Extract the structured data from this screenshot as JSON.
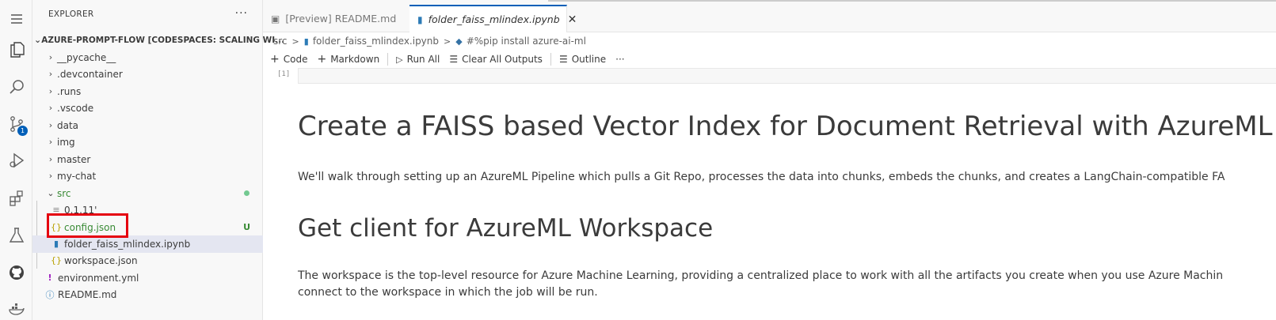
{
  "activity_bar": {
    "items": [
      "files-icon",
      "search-icon",
      "source-control-icon",
      "run-debug-icon",
      "extensions-icon",
      "testing-icon",
      "github-icon",
      "docker-icon"
    ],
    "source_control_badge": "1"
  },
  "explorer": {
    "title": "EXPLORER",
    "more": "···",
    "root": "AZURE-PROMPT-FLOW [CODESPACES: SCALING WI...",
    "items": [
      {
        "label": "__pycache__"
      },
      {
        "label": ".devcontainer"
      },
      {
        "label": ".runs"
      },
      {
        "label": ".vscode"
      },
      {
        "label": "data"
      },
      {
        "label": "img"
      },
      {
        "label": "master"
      },
      {
        "label": "my-chat"
      },
      {
        "label": "src"
      },
      {
        "label": "0.1.11'"
      },
      {
        "label": "config.json",
        "status": "U"
      },
      {
        "label": "folder_faiss_mlindex.ipynb"
      },
      {
        "label": "workspace.json"
      },
      {
        "label": "environment.yml"
      },
      {
        "label": "README.md"
      }
    ]
  },
  "tabs": [
    {
      "label": "[Preview] README.md"
    },
    {
      "label": "folder_faiss_mlindex.ipynb",
      "close": "✕"
    }
  ],
  "breadcrumb": {
    "items": [
      "src",
      "folder_faiss_mlindex.ipynb",
      "#%pip install azure-ai-ml"
    ],
    "separator": ">"
  },
  "toolbar": {
    "code": "Code",
    "markdown": "Markdown",
    "run_all": "Run All",
    "clear_outputs": "Clear All Outputs",
    "outline": "Outline",
    "more": "···"
  },
  "notebook": {
    "exec_count": "[1]",
    "h1": "Create a FAISS based Vector Index for Document Retrieval with AzureML",
    "p1": "We'll walk through setting up an AzureML Pipeline which pulls a Git Repo, processes the data into chunks, embeds the chunks, and creates a LangChain-compatible FA",
    "h2": "Get client for AzureML Workspace",
    "p2_line1": "The workspace is the top-level resource for Azure Machine Learning, providing a centralized place to work with all the artifacts you create when you use Azure Machin",
    "p2_line2": "connect to the workspace in which the job will be run."
  },
  "colors": {
    "accent": "#005fb8",
    "untracked": "#388a34",
    "highlight": "#e5000f"
  }
}
